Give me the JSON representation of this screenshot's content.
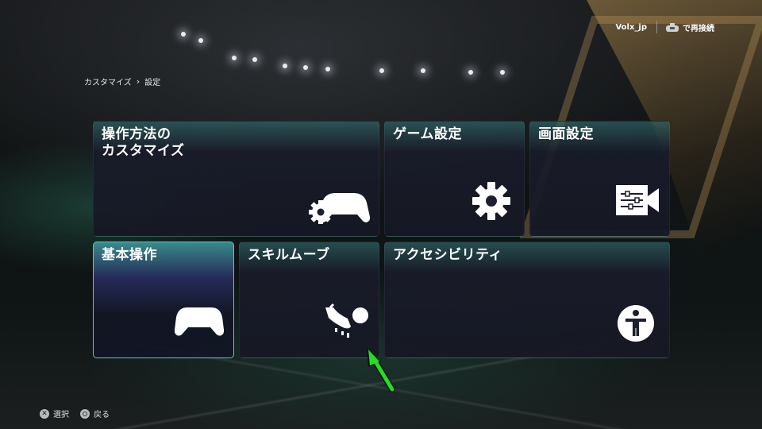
{
  "topbar": {
    "username": "Volx_jp",
    "reconnect_label": "で再接続"
  },
  "breadcrumb": {
    "parent": "カスタマイズ",
    "current": "設定"
  },
  "tiles": [
    {
      "label": "操作方法の\nカスタマイズ",
      "icon": "gear-controller-icon"
    },
    {
      "label": "ゲーム設定",
      "icon": "gear-icon"
    },
    {
      "label": "画面設定",
      "icon": "video-settings-icon"
    },
    {
      "label": "基本操作",
      "icon": "controller-icon",
      "selected": true
    },
    {
      "label": "スキルムーブ",
      "icon": "boot-ball-icon"
    },
    {
      "label": "アクセシビリティ",
      "icon": "accessibility-icon"
    }
  ],
  "hints": {
    "select_label": "選択",
    "back_label": "戻る"
  },
  "colors": {
    "selected_border": "#5ec6c2",
    "cursor": "#22dd22"
  }
}
